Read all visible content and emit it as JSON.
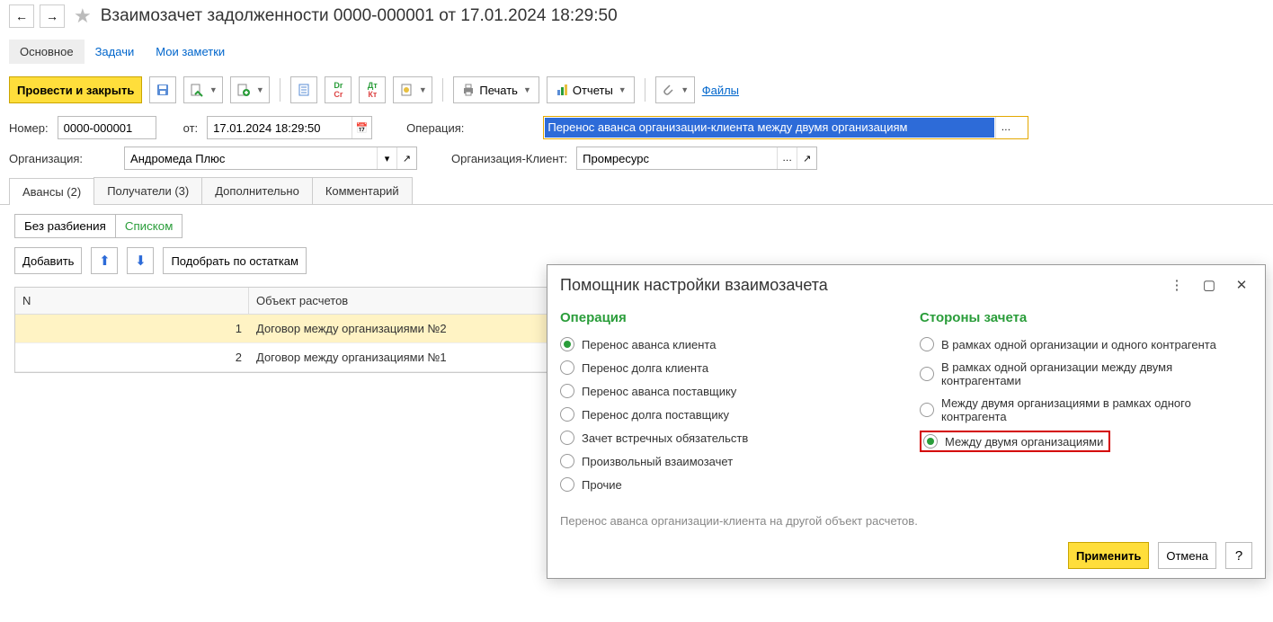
{
  "header": {
    "title": "Взаимозачет задолженности 0000-000001 от 17.01.2024 18:29:50"
  },
  "navTabs": {
    "main": "Основное",
    "tasks": "Задачи",
    "notes": "Мои заметки"
  },
  "toolbar": {
    "postClose": "Провести и закрыть",
    "print": "Печать",
    "reports": "Отчеты",
    "files": "Файлы"
  },
  "form": {
    "numberLabel": "Номер:",
    "number": "0000-000001",
    "fromLabel": "от:",
    "date": "17.01.2024 18:29:50",
    "operationLabel": "Операция:",
    "operation": "Перенос аванса организации-клиента между двумя организациям",
    "orgLabel": "Организация:",
    "org": "Андромеда Плюс",
    "orgClientLabel": "Организация-Клиент:",
    "orgClient": "Промресурс"
  },
  "docTabs": {
    "advances": "Авансы (2)",
    "recipients": "Получатели (3)",
    "more": "Дополнительно",
    "comment": "Комментарий"
  },
  "modes": {
    "nosplit": "Без разбиения",
    "list": "Списком"
  },
  "actions": {
    "add": "Добавить",
    "pickRemain": "Подобрать по остаткам"
  },
  "table": {
    "colN": "N",
    "colObj": "Объект расчетов",
    "rows": [
      {
        "n": "1",
        "obj": "Договор между организациями №2"
      },
      {
        "n": "2",
        "obj": "Договор между организациями №1"
      }
    ]
  },
  "dialog": {
    "title": "Помощник настройки взаимозачета",
    "opHeading": "Операция",
    "ops": [
      "Перенос аванса клиента",
      "Перенос долга клиента",
      "Перенос аванса поставщику",
      "Перенос долга поставщику",
      "Зачет встречных обязательств",
      "Произвольный взаимозачет",
      "Прочие"
    ],
    "sidesHeading": "Стороны зачета",
    "sides": [
      "В рамках одной организации и одного контрагента",
      "В рамках одной организации между двумя контрагентами",
      "Между двумя организациями в рамках одного контрагента",
      "Между двумя организациями"
    ],
    "desc": "Перенос аванса организации-клиента на другой объект расчетов.",
    "apply": "Применить",
    "cancel": "Отмена"
  }
}
